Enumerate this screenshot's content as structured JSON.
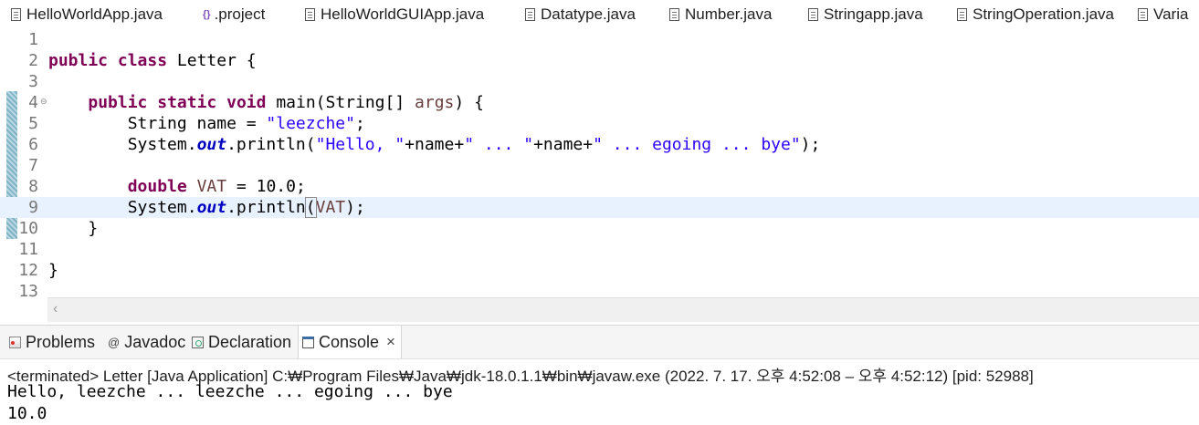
{
  "editor_tabs": [
    {
      "label": "HelloWorldApp.java",
      "icon": "java-file-icon"
    },
    {
      "label": ".project",
      "icon": "xml-file-icon"
    },
    {
      "label": "HelloWorldGUIApp.java",
      "icon": "java-file-icon"
    },
    {
      "label": "Datatype.java",
      "icon": "java-file-icon"
    },
    {
      "label": "Number.java",
      "icon": "java-file-icon"
    },
    {
      "label": "Stringapp.java",
      "icon": "java-file-icon"
    },
    {
      "label": "StringOperation.java",
      "icon": "java-file-icon"
    },
    {
      "label": "Varia",
      "icon": "java-file-icon"
    }
  ],
  "editor": {
    "current_line": 9,
    "line_numbers": [
      "1",
      "2",
      "3",
      "4",
      "5",
      "6",
      "7",
      "8",
      "9",
      "10",
      "11",
      "12",
      "13"
    ],
    "code": {
      "l2_kw1": "public",
      "l2_kw2": "class",
      "l2_name": "Letter {",
      "l4_kw1": "public",
      "l4_kw2": "static",
      "l4_kw3": "void",
      "l4_sig": "main(String[] ",
      "l4_param": "args",
      "l4_end": ") {",
      "l5_type": "String name = ",
      "l5_str": "\"leezche\"",
      "l5_end": ";",
      "l6_sys": "System.",
      "l6_out": "out",
      "l6_call": ".println(",
      "l6_s1": "\"Hello, \"",
      "l6_p1": "+name+",
      "l6_s2": "\" ... \"",
      "l6_p2": "+name+",
      "l6_s3": "\" ... egoing ... bye\"",
      "l6_end": ");",
      "l8_kw": "double",
      "l8_var": "VAT",
      "l8_rest": " = 10.0;",
      "l9_sys": "System.",
      "l9_out": "out",
      "l9_call": ".println",
      "l9_paren": "(",
      "l9_var": "VAT",
      "l9_end": ");",
      "l10": "}",
      "l12": "}"
    }
  },
  "panel": {
    "tabs": [
      {
        "label": "Problems",
        "icon": "problems-icon"
      },
      {
        "label": "Javadoc",
        "icon": "javadoc-icon"
      },
      {
        "label": "Declaration",
        "icon": "declaration-icon"
      },
      {
        "label": "Console",
        "icon": "console-icon",
        "active": true
      }
    ],
    "status": "<terminated> Letter [Java Application] C:₩Program Files₩Java₩jdk-18.0.1.1₩bin₩javaw.exe  (2022. 7. 17. 오후 4:52:08 – 오후 4:52:12) [pid: 52988]",
    "output": [
      "Hello, leezche ... leezche ... egoing ... bye",
      "10.0"
    ]
  },
  "colors": {
    "keyword": "#7f0055",
    "string": "#2a00ff",
    "static_field": "#0000c0",
    "local_variable": "#6a3e3e",
    "current_line": "#e8f2fe"
  }
}
